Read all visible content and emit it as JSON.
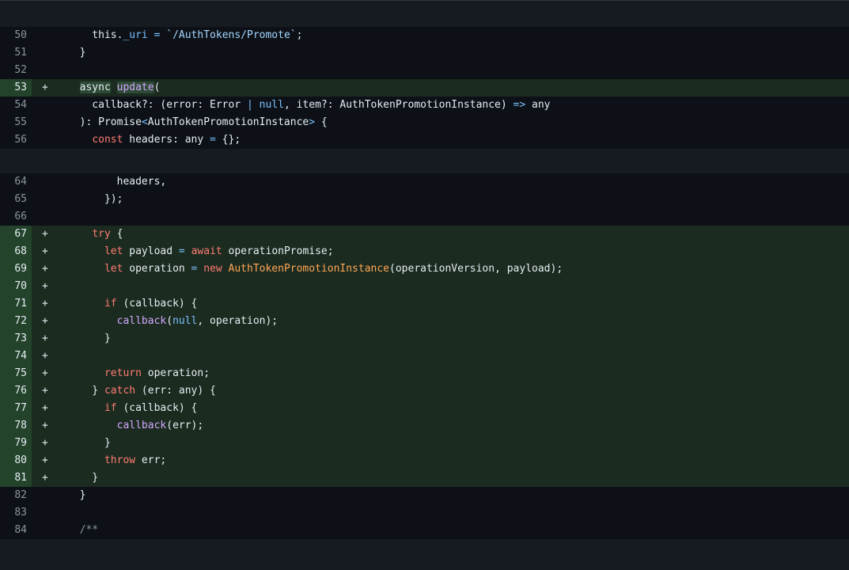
{
  "diff": {
    "hunks": [
      {
        "lines": [
          {
            "num": "50",
            "added": false,
            "tokens": [
              {
                "t": "    this."
              },
              {
                "t": "_uri",
                "c": "c"
              },
              {
                "t": " "
              },
              {
                "t": "=",
                "c": "c"
              },
              {
                "t": " "
              },
              {
                "t": "`/AuthTokens/Promote`",
                "c": "s"
              },
              {
                "t": ";"
              }
            ]
          },
          {
            "num": "51",
            "added": false,
            "tokens": [
              {
                "t": "  }"
              }
            ]
          },
          {
            "num": "52",
            "added": false,
            "tokens": [
              {
                "t": ""
              }
            ]
          },
          {
            "num": "53",
            "added": true,
            "tokens": [
              {
                "t": "  "
              },
              {
                "t": "async",
                "c": "hl"
              },
              {
                "t": " "
              },
              {
                "t": "update",
                "c": "hl f"
              },
              {
                "t": "("
              }
            ]
          },
          {
            "num": "54",
            "added": false,
            "tokens": [
              {
                "t": "    callback?: (error: Error "
              },
              {
                "t": "|",
                "c": "c"
              },
              {
                "t": " "
              },
              {
                "t": "null",
                "c": "c"
              },
              {
                "t": ", item?: AuthTokenPromotionInstance) "
              },
              {
                "t": "=>",
                "c": "c"
              },
              {
                "t": " any"
              }
            ]
          },
          {
            "num": "55",
            "added": false,
            "tokens": [
              {
                "t": "  ): Promise"
              },
              {
                "t": "<",
                "c": "c"
              },
              {
                "t": "AuthTokenPromotionInstance"
              },
              {
                "t": ">",
                "c": "c"
              },
              {
                "t": " {"
              }
            ]
          },
          {
            "num": "56",
            "added": false,
            "tokens": [
              {
                "t": "    "
              },
              {
                "t": "const",
                "c": "k"
              },
              {
                "t": " headers: any "
              },
              {
                "t": "=",
                "c": "c"
              },
              {
                "t": " {};"
              }
            ]
          }
        ]
      },
      {
        "lines": [
          {
            "num": "64",
            "added": false,
            "tokens": [
              {
                "t": "        headers,"
              }
            ]
          },
          {
            "num": "65",
            "added": false,
            "tokens": [
              {
                "t": "      });"
              }
            ]
          },
          {
            "num": "66",
            "added": false,
            "tokens": [
              {
                "t": ""
              }
            ]
          },
          {
            "num": "67",
            "added": true,
            "tokens": [
              {
                "t": "    "
              },
              {
                "t": "try",
                "c": "k"
              },
              {
                "t": " {"
              }
            ]
          },
          {
            "num": "68",
            "added": true,
            "tokens": [
              {
                "t": "      "
              },
              {
                "t": "let",
                "c": "k"
              },
              {
                "t": " payload "
              },
              {
                "t": "=",
                "c": "c"
              },
              {
                "t": " "
              },
              {
                "t": "await",
                "c": "k"
              },
              {
                "t": " operationPromise;"
              }
            ]
          },
          {
            "num": "69",
            "added": true,
            "tokens": [
              {
                "t": "      "
              },
              {
                "t": "let",
                "c": "k"
              },
              {
                "t": " operation "
              },
              {
                "t": "=",
                "c": "c"
              },
              {
                "t": " "
              },
              {
                "t": "new",
                "c": "k"
              },
              {
                "t": " "
              },
              {
                "t": "AuthTokenPromotionInstance",
                "c": "o"
              },
              {
                "t": "(operationVersion, payload);"
              }
            ]
          },
          {
            "num": "70",
            "added": true,
            "tokens": [
              {
                "t": ""
              }
            ]
          },
          {
            "num": "71",
            "added": true,
            "tokens": [
              {
                "t": "      "
              },
              {
                "t": "if",
                "c": "k"
              },
              {
                "t": " (callback) {"
              }
            ]
          },
          {
            "num": "72",
            "added": true,
            "tokens": [
              {
                "t": "        "
              },
              {
                "t": "callback",
                "c": "f"
              },
              {
                "t": "("
              },
              {
                "t": "null",
                "c": "c"
              },
              {
                "t": ", operation);"
              }
            ]
          },
          {
            "num": "73",
            "added": true,
            "tokens": [
              {
                "t": "      }"
              }
            ]
          },
          {
            "num": "74",
            "added": true,
            "tokens": [
              {
                "t": ""
              }
            ]
          },
          {
            "num": "75",
            "added": true,
            "tokens": [
              {
                "t": "      "
              },
              {
                "t": "return",
                "c": "k"
              },
              {
                "t": " operation;"
              }
            ]
          },
          {
            "num": "76",
            "added": true,
            "tokens": [
              {
                "t": "    } "
              },
              {
                "t": "catch",
                "c": "k"
              },
              {
                "t": " (err: any) {"
              }
            ]
          },
          {
            "num": "77",
            "added": true,
            "tokens": [
              {
                "t": "      "
              },
              {
                "t": "if",
                "c": "k"
              },
              {
                "t": " (callback) {"
              }
            ]
          },
          {
            "num": "78",
            "added": true,
            "tokens": [
              {
                "t": "        "
              },
              {
                "t": "callback",
                "c": "f"
              },
              {
                "t": "(err);"
              }
            ]
          },
          {
            "num": "79",
            "added": true,
            "tokens": [
              {
                "t": "      }"
              }
            ]
          },
          {
            "num": "80",
            "added": true,
            "tokens": [
              {
                "t": "      "
              },
              {
                "t": "throw",
                "c": "k"
              },
              {
                "t": " err;"
              }
            ]
          },
          {
            "num": "81",
            "added": true,
            "tokens": [
              {
                "t": "    }"
              }
            ]
          },
          {
            "num": "82",
            "added": false,
            "tokens": [
              {
                "t": "  }"
              }
            ]
          },
          {
            "num": "83",
            "added": false,
            "tokens": [
              {
                "t": ""
              }
            ]
          },
          {
            "num": "84",
            "added": false,
            "tokens": [
              {
                "t": "  "
              },
              {
                "t": "/**",
                "c": "cm"
              }
            ]
          }
        ]
      }
    ],
    "added_marker": "+"
  },
  "colors": {
    "background": "#0d1117",
    "hunk_separator": "#161b22",
    "added_line": "#1b2b1f",
    "added_gutter": "#23432b",
    "keyword": "#ff7b72",
    "string": "#a5d6ff",
    "constant": "#79c0ff",
    "function": "#d2a8ff",
    "class": "#ffa657"
  }
}
